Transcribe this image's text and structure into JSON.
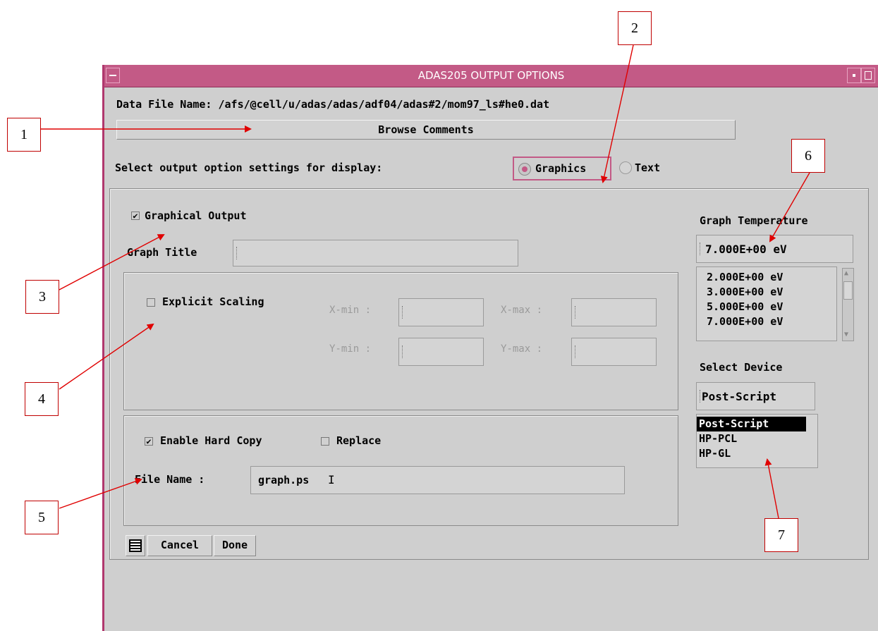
{
  "window": {
    "title": "ADAS205 OUTPUT OPTIONS"
  },
  "header": {
    "data_file_label": "Data File Name:",
    "data_file_path": "/afs/@cell/u/adas/adas/adf04/adas#2/mom97_ls#he0.dat",
    "browse_label": "Browse Comments",
    "select_prompt": "Select output option settings for display:",
    "radio_graphics": "Graphics",
    "radio_text": "Text"
  },
  "graphics": {
    "graphical_output_label": "Graphical Output",
    "graphical_output_checked": true,
    "graph_title_label": "Graph Title",
    "graph_title_value": "",
    "explicit_scaling_label": "Explicit Scaling",
    "explicit_scaling_checked": false,
    "xmin_label": "X-min :",
    "xmax_label": "X-max :",
    "ymin_label": "Y-min :",
    "ymax_label": "Y-max :"
  },
  "hardcopy": {
    "enable_label": "Enable Hard Copy",
    "enable_checked": true,
    "replace_label": "Replace",
    "replace_checked": false,
    "file_name_label": "File Name :",
    "file_name_value": "graph.ps"
  },
  "temperature": {
    "label": "Graph Temperature",
    "selected": "7.000E+00 eV",
    "options": [
      "2.000E+00 eV",
      "3.000E+00 eV",
      "5.000E+00 eV",
      "7.000E+00 eV"
    ]
  },
  "device": {
    "label": "Select Device",
    "selected": "Post-Script",
    "options": [
      "Post-Script",
      "HP-PCL",
      "HP-GL"
    ]
  },
  "footer": {
    "cancel_label": "Cancel",
    "done_label": "Done"
  },
  "callouts": [
    "1",
    "2",
    "3",
    "4",
    "5",
    "6",
    "7"
  ],
  "colors": {
    "title_bar": "#c35a86",
    "annotation": "#e00000"
  }
}
